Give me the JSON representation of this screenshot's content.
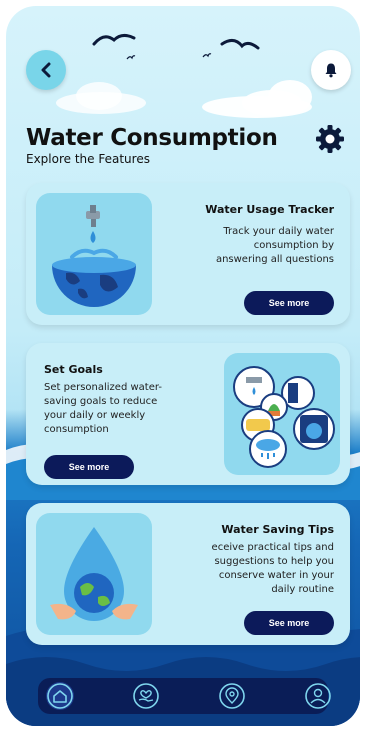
{
  "header": {
    "title": "Water Consumption",
    "subtitle": "Explore the Features"
  },
  "cards": [
    {
      "title": "Water Usage Tracker",
      "description": [
        "Track your daily water",
        "consumption by",
        "answering all questions"
      ],
      "button": "See more",
      "icon": "earth-faucet-icon"
    },
    {
      "title": "Set Goals",
      "description": [
        "Set personalized water-",
        "saving goals to reduce",
        "your daily or weekly",
        "consumption"
      ],
      "button": "See more",
      "icon": "household-water-icon"
    },
    {
      "title": "Water Saving Tips",
      "description": [
        "eceive practical tips and",
        "suggestions to help you",
        "conserve water in your",
        "daily routine"
      ],
      "button": "See more",
      "icon": "earth-in-drop-icon"
    }
  ],
  "nav": {
    "items": [
      "home-icon",
      "heart-hand-icon",
      "location-icon",
      "profile-icon"
    ],
    "active": "home-icon"
  },
  "colors": {
    "nav_bg": "#0a1d57",
    "button_bg": "#0c1a5a",
    "card_bg": "#c8eef8",
    "accent": "#79d5e9"
  }
}
